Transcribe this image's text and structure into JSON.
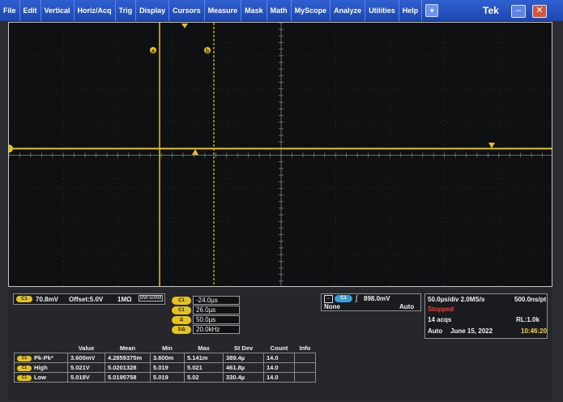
{
  "menu": {
    "items": [
      "File",
      "Edit",
      "Vertical",
      "Horiz/Acq",
      "Trig",
      "Display",
      "Cursors",
      "Measure",
      "Mask",
      "Math",
      "MyScope",
      "Analyze",
      "Utilities",
      "Help"
    ],
    "extra_icon": "dropdown-icon",
    "brand": "Tek",
    "min_label": "–",
    "close_label": "✕"
  },
  "waveform": {
    "color": "#e6c21f",
    "level_fraction": 0.475
  },
  "channel": {
    "badge": "C1",
    "scale": "70.8mV",
    "offset": "Offset:5.0V",
    "impedance": "1MΩ",
    "bw": "BW:500M"
  },
  "cursors": {
    "a_label": "a",
    "b_label": "b",
    "values": [
      "-24.0µs",
      "26.0µs",
      "50.0µs",
      "20.0kHz"
    ],
    "labels": [
      "C1",
      "C1",
      "Δ",
      "1/Δ"
    ]
  },
  "trigger": {
    "source": "C1",
    "level": "898.0mV",
    "mode_left": "None",
    "mode_right": "Auto"
  },
  "horizontal": {
    "scale": "50.0µs/div  2.0MS/s",
    "resolution": "500.0ns/pt",
    "state": "Stopped",
    "acqs": "14 acqs",
    "record": "RL:1.0k",
    "mode": "Auto",
    "date": "June 15, 2022",
    "time": "10:46:20"
  },
  "measurements": {
    "headers": [
      "",
      "Value",
      "Mean",
      "Min",
      "Max",
      "St Dev",
      "Count",
      "Info"
    ],
    "rows": [
      {
        "badge": "C1",
        "name": "Pk-Pk*",
        "value": "3.600mV",
        "mean": "4.2859375m",
        "min": "3.600m",
        "max": "5.141m",
        "stdev": "389.4µ",
        "count": "14.0",
        "info": ""
      },
      {
        "badge": "C1",
        "name": "High",
        "value": "5.021V",
        "mean": "5.0201328",
        "min": "5.019",
        "max": "5.021",
        "stdev": "461.8µ",
        "count": "14.0",
        "info": ""
      },
      {
        "badge": "C1",
        "name": "Low",
        "value": "5.018V",
        "mean": "5.0195758",
        "min": "5.019",
        "max": "5.02",
        "stdev": "330.4µ",
        "count": "14.0",
        "info": ""
      }
    ]
  }
}
